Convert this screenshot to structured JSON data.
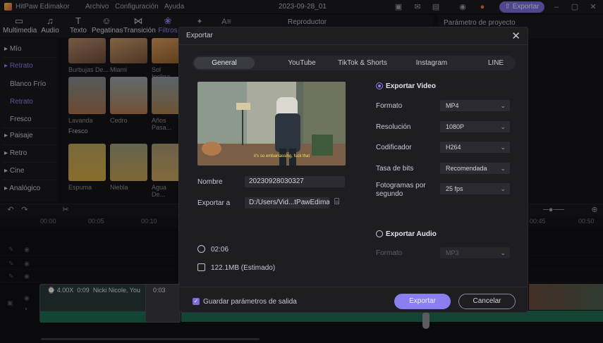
{
  "app": {
    "name": "HitPaw Edimakor",
    "menu": [
      "Archivo",
      "Configuración",
      "Ayuda"
    ],
    "project_title": "2023-09-28_01",
    "export_button": "Exportar"
  },
  "toolbar": {
    "tools": [
      {
        "label": "Multimedia",
        "icon": "media-icon"
      },
      {
        "label": "Audio",
        "icon": "music-icon"
      },
      {
        "label": "Texto",
        "icon": "text-icon"
      },
      {
        "label": "Pegatinas",
        "icon": "sticker-icon"
      },
      {
        "label": "Transición",
        "icon": "transition-icon"
      },
      {
        "label": "Filtros",
        "icon": "filter-icon"
      }
    ]
  },
  "side_panel": {
    "categories": [
      "Mío",
      "Retrato",
      "Blanco Frío",
      "Retrato",
      "Fresco",
      "Paisaje",
      "Retro",
      "Cine",
      "Analógico"
    ]
  },
  "media_grid": {
    "items": [
      {
        "label": "Burbujas De..."
      },
      {
        "label": "Miami"
      },
      {
        "label": "Sol Inclina..."
      },
      {
        "label": "Lavanda"
      },
      {
        "label": "Cedro"
      },
      {
        "label": "Años Pasa..."
      },
      {
        "label": "Espuma"
      },
      {
        "label": "Niebla"
      },
      {
        "label": "Agua De..."
      }
    ],
    "section_label": "Fresco"
  },
  "panels": {
    "player_title": "Reproductor",
    "params_title": "Parámetro de proyecto"
  },
  "timeline": {
    "ruler": [
      "00:00",
      "00:05",
      "00:10",
      "00:45",
      "00:50"
    ],
    "clip": {
      "speed": "4.00X",
      "duration": "0:09",
      "name": "Nicki Nicole, You",
      "second_duration": "0:03"
    }
  },
  "dialog": {
    "title": "Exportar",
    "tabs": [
      "General",
      "YouTube",
      "TikTok & Shorts",
      "Instagram",
      "LINE"
    ],
    "active_tab": "General",
    "preview_caption": "it's so embarrassing, fuck that",
    "name_label": "Nombre",
    "name_value": "20230928030327",
    "export_to_label": "Exportar a",
    "export_path": "D:/Users/Vid...tPawEdimakor",
    "duration": "02:06",
    "size": "122.1MB (Estimado)",
    "video": {
      "section": "Exportar Video",
      "format_label": "Formato",
      "format": "MP4",
      "resolution_label": "Resolución",
      "resolution": "1080P",
      "codec_label": "Codificador",
      "codec": "H264",
      "bitrate_label": "Tasa de bits",
      "bitrate": "Recomendada",
      "fps_label": "Fotogramas por segundo",
      "fps": "25  fps"
    },
    "audio": {
      "section": "Exportar Audio",
      "format_label": "Formato",
      "format": "MP3"
    },
    "save_params_label": "Guardar parámetros de salida",
    "export_button": "Exportar",
    "cancel_button": "Cancelar"
  },
  "colors": {
    "accent": "#8b7ff0",
    "background": "#131317",
    "dialog": "#1d1d22"
  }
}
